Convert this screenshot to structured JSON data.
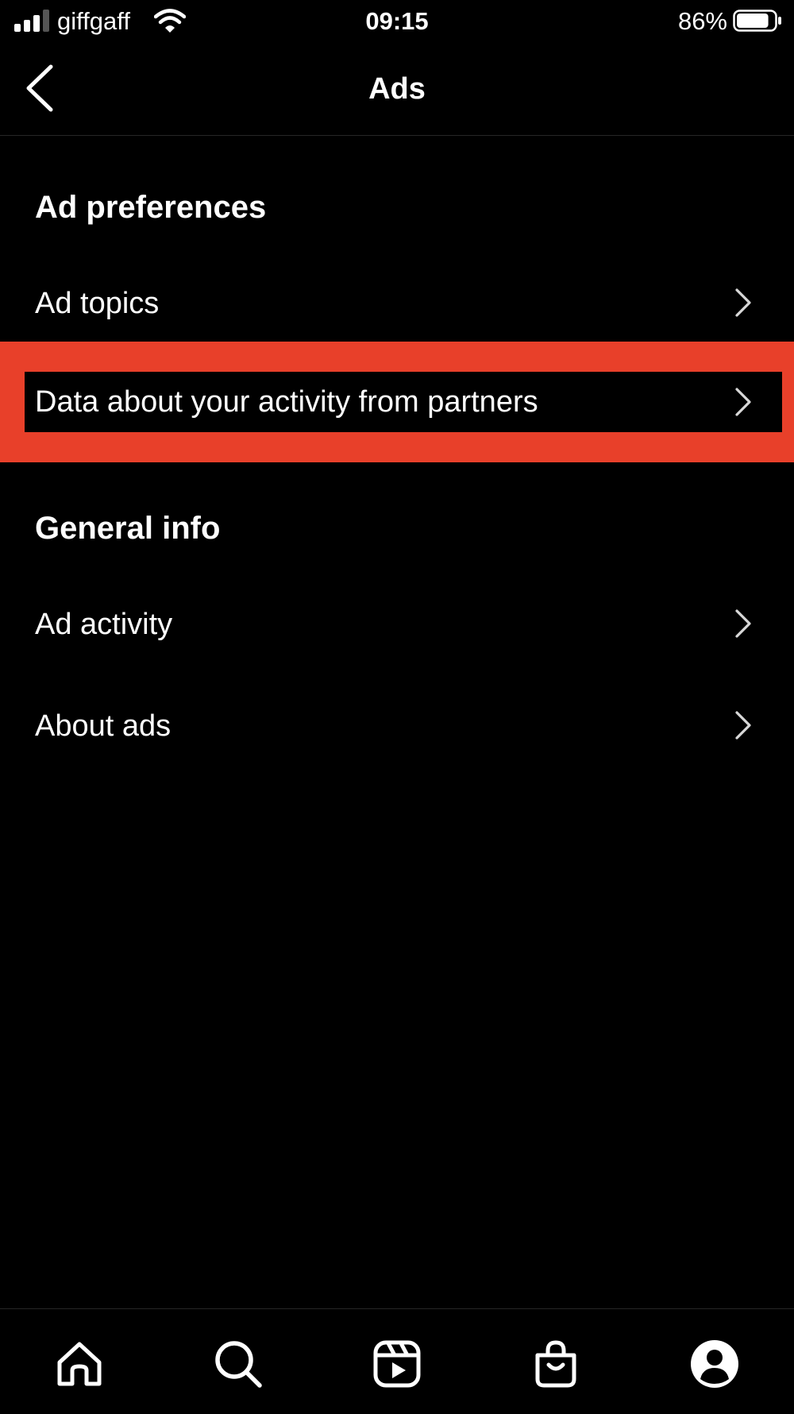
{
  "status_bar": {
    "carrier": "giffgaff",
    "time": "09:15",
    "battery_percent": "86%",
    "battery_level": 0.86,
    "signal_bars": 3,
    "signal_bars_total": 4
  },
  "header": {
    "title": "Ads",
    "back_icon": "chevron-left-icon"
  },
  "sections": [
    {
      "heading": "Ad preferences",
      "items": [
        {
          "label": "Ad topics",
          "icon": "chevron-right-icon"
        },
        {
          "label": "Data about your activity from partners",
          "icon": "chevron-right-icon",
          "highlighted": true
        }
      ]
    },
    {
      "heading": "General info",
      "items": [
        {
          "label": "Ad activity",
          "icon": "chevron-right-icon"
        },
        {
          "label": "About ads",
          "icon": "chevron-right-icon"
        }
      ]
    }
  ],
  "tab_bar": {
    "tabs": [
      {
        "name": "home",
        "icon": "home-icon"
      },
      {
        "name": "search",
        "icon": "search-icon"
      },
      {
        "name": "reels",
        "icon": "reels-icon"
      },
      {
        "name": "shop",
        "icon": "shopping-bag-icon"
      },
      {
        "name": "profile",
        "icon": "profile-icon"
      }
    ]
  },
  "colors": {
    "background": "#000000",
    "text": "#ffffff",
    "highlight": "#e8402a",
    "divider": "#262626"
  }
}
